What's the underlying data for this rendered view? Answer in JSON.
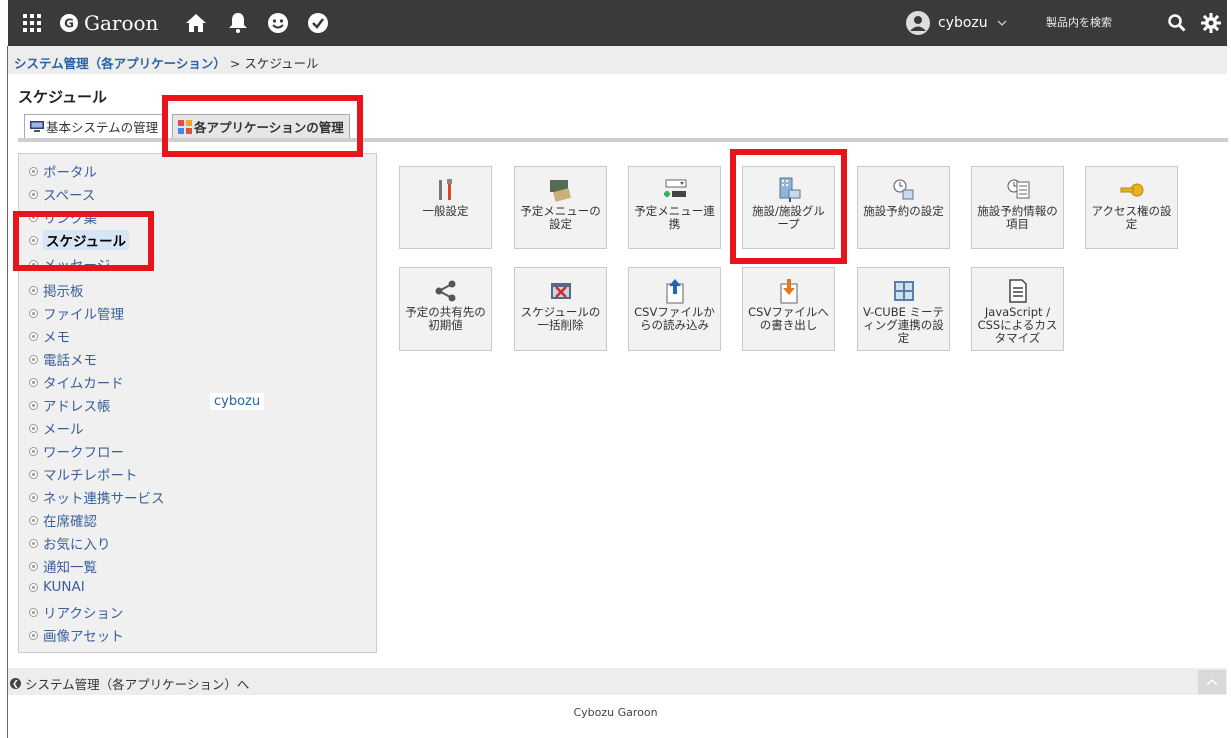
{
  "header": {
    "logo": "Garoon",
    "user": "cybozu",
    "search_placeholder": "製品内を検索"
  },
  "breadcrumb": {
    "parent": "システム管理（各アプリケーション）",
    "separator": " > ",
    "current": "スケジュール"
  },
  "page_title": "スケジュール",
  "tabs": [
    {
      "label": "基本システムの管理"
    },
    {
      "label": "各アプリケーションの管理"
    }
  ],
  "menu": [
    "ポータル",
    "スペース",
    "リンク集",
    "スケジュール",
    "メッセージ",
    "掲示板",
    "ファイル管理",
    "メモ",
    "電話メモ",
    "タイムカード",
    "アドレス帳",
    "メール",
    "ワークフロー",
    "マルチレポート",
    "ネット連携サービス",
    "在席確認",
    "お気に入り",
    "通知一覧",
    "KUNAI",
    "リアクション",
    "画像アセット"
  ],
  "floating_user": "cybozu",
  "tiles": [
    {
      "l1": "一般設定",
      "l2": "",
      "l3": ""
    },
    {
      "l1": "予定メニューの",
      "l2": "設定",
      "l3": ""
    },
    {
      "l1": "予定メニュー連",
      "l2": "携",
      "l3": ""
    },
    {
      "l1": "施設/施設グル",
      "l2": "ープ",
      "l3": ""
    },
    {
      "l1": "施設予約の設定",
      "l2": "",
      "l3": ""
    },
    {
      "l1": "施設予約情報の",
      "l2": "項目",
      "l3": ""
    },
    {
      "l1": "アクセス権の設",
      "l2": "定",
      "l3": ""
    },
    {
      "l1": "予定の共有先の",
      "l2": "初期値",
      "l3": ""
    },
    {
      "l1": "スケジュールの",
      "l2": "一括削除",
      "l3": ""
    },
    {
      "l1": "CSVファイルか",
      "l2": "らの読み込み",
      "l3": ""
    },
    {
      "l1": "CSVファイルへ",
      "l2": "の書き出し",
      "l3": ""
    },
    {
      "l1": "V-CUBE ミーテ",
      "l2": "ィング連携の設",
      "l3": "定"
    },
    {
      "l1": "JavaScript /",
      "l2": "CSSによるカス",
      "l3": "タマイズ"
    }
  ],
  "bottom": {
    "back_link": "システム管理（各アプリケーション）へ"
  },
  "footer": "Cybozu Garoon",
  "colors": {
    "header_bg": "#3a3a3a",
    "link": "#2b62a7",
    "highlight": "#e8141a"
  }
}
